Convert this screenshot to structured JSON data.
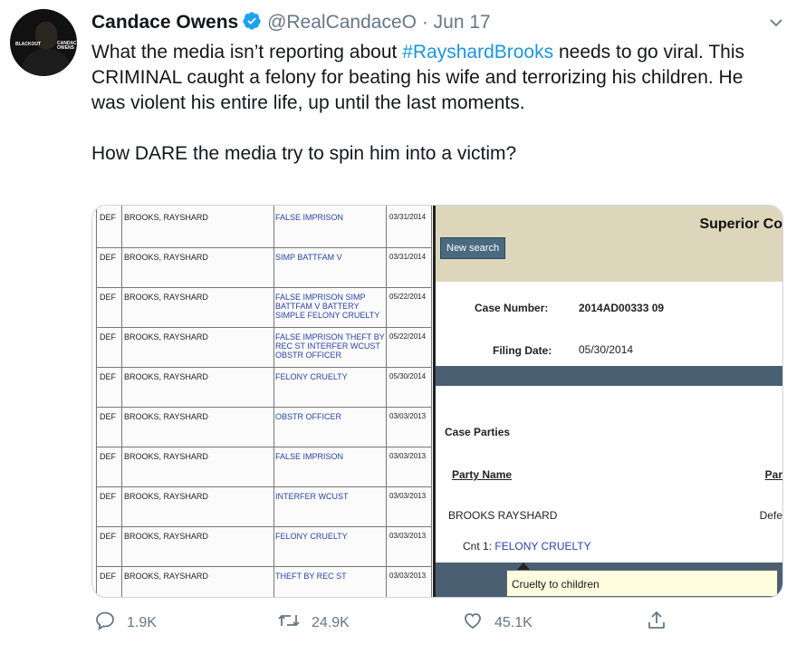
{
  "tweet": {
    "author_name": "Candace Owens",
    "handle": "@RealCandaceO",
    "separator": "·",
    "date": "Jun 17",
    "text_before_hashtag": "What the media isn’t reporting about ",
    "hashtag": "#RayshardBrooks",
    "text_after_hashtag": " needs to go viral. This CRIMINAL caught a felony for beating his wife and terrorizing his children. He was violent his entire life, up until the last moments.",
    "text_second_paragraph": "How DARE the media try to spin him into a victim?"
  },
  "avatar": {
    "tag_left": "BLACKOUT",
    "tag_right": "CANDACE OWENS"
  },
  "records": [
    {
      "type": "DEF",
      "name": "BROOKS, RAYSHARD",
      "charge": "FALSE IMPRISON",
      "date": "03/31/2014"
    },
    {
      "type": "DEF",
      "name": "BROOKS, RAYSHARD",
      "charge": "SIMP BATTFAM V",
      "date": "03/31/2014"
    },
    {
      "type": "DEF",
      "name": "BROOKS, RAYSHARD",
      "charge": "FALSE IMPRISON SIMP BATTFAM V BATTERY SIMPLE FELONY CRUELTY",
      "date": "05/22/2014"
    },
    {
      "type": "DEF",
      "name": "BROOKS, RAYSHARD",
      "charge": "FALSE IMPRISON THEFT BY REC ST INTERFER WCUST OBSTR OFFICER",
      "date": "05/22/2014"
    },
    {
      "type": "DEF",
      "name": "BROOKS, RAYSHARD",
      "charge": "FELONY CRUELTY",
      "date": "05/30/2014"
    },
    {
      "type": "DEF",
      "name": "BROOKS, RAYSHARD",
      "charge": "OBSTR OFFICER",
      "date": "03/03/2013"
    },
    {
      "type": "DEF",
      "name": "BROOKS, RAYSHARD",
      "charge": "FALSE IMPRISON",
      "date": "03/03/2013"
    },
    {
      "type": "DEF",
      "name": "BROOKS, RAYSHARD",
      "charge": "INTERFER WCUST",
      "date": "03/03/2013"
    },
    {
      "type": "DEF",
      "name": "BROOKS, RAYSHARD",
      "charge": "FELONY CRUELTY",
      "date": "03/03/2013"
    },
    {
      "type": "DEF",
      "name": "BROOKS, RAYSHARD",
      "charge": "THEFT BY REC ST",
      "date": "03/03/2013"
    }
  ],
  "court": {
    "title": "Superior Co",
    "new_search": "New search",
    "case_number_label": "Case Number:",
    "case_number": "2014AD00333  09",
    "filing_date_label": "Filing Date:",
    "filing_date": "05/30/2014",
    "case_parties": "Case Parties",
    "party_name_header": "Party Name",
    "party_type_header": "Par",
    "party_name": "BROOKS RAYSHARD",
    "party_type": "Defe",
    "count_prefix": "Cnt 1: ",
    "count_charge": "FELONY CRUELTY",
    "tooltip": "Cruelty to children"
  },
  "actions": {
    "replies": "1.9K",
    "retweets": "24.9K",
    "likes": "45.1K"
  },
  "colors": {
    "hashtag": "#1b95e0",
    "secondary": "#657786",
    "verified": "#1da1f2"
  }
}
